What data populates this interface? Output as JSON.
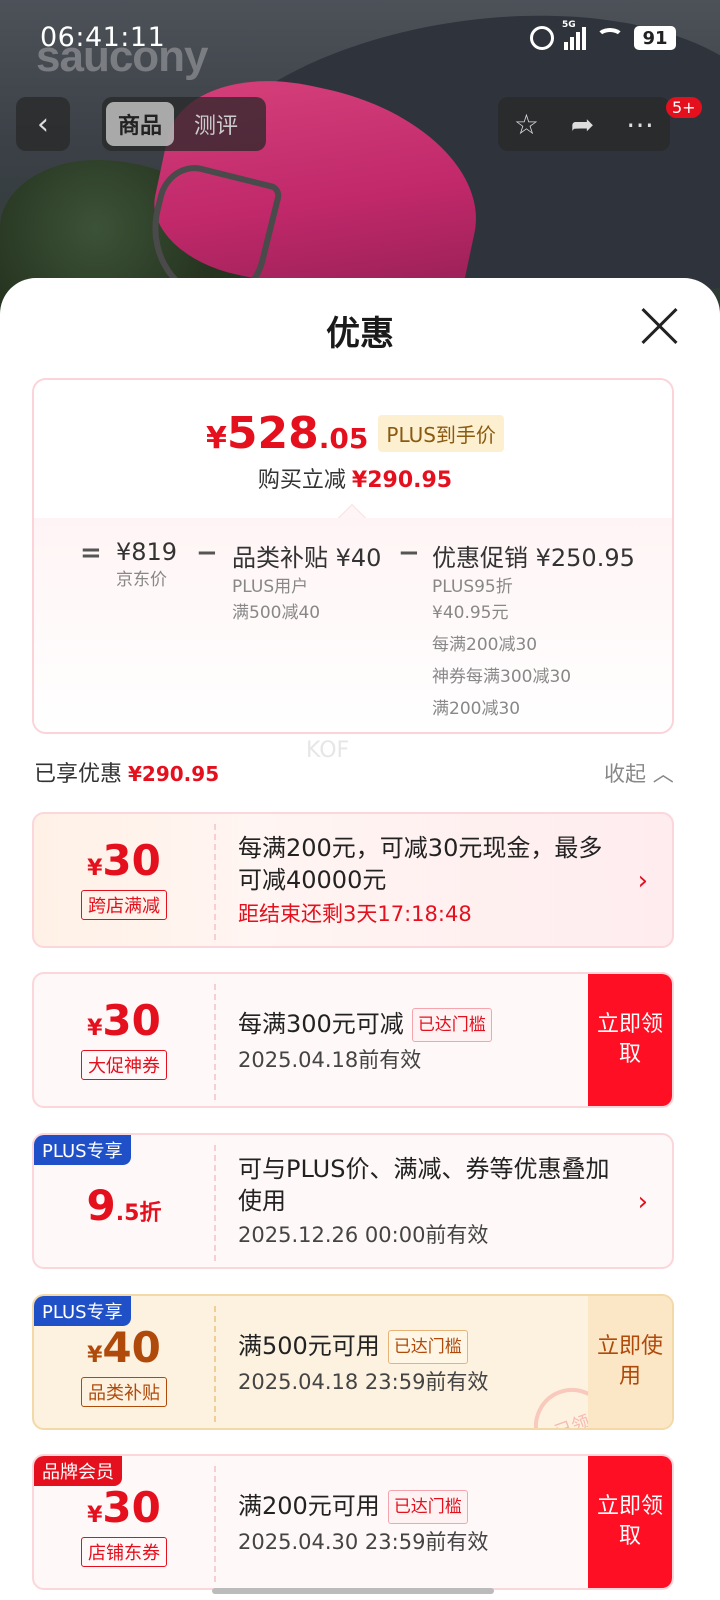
{
  "status": {
    "time": "06:41:11",
    "network": "5G",
    "battery": "91"
  },
  "background": {
    "brand": "saucony"
  },
  "nav": {
    "back_icon": "chevron-left-icon",
    "tabs": [
      {
        "label": "商品",
        "active": true
      },
      {
        "label": "测评",
        "active": false
      }
    ],
    "badge": "5+"
  },
  "sheet": {
    "title": "优惠",
    "summary": {
      "currency": "¥",
      "price_int": "528",
      "price_dec": ".05",
      "plus_label": "PLUS到手价",
      "reduce_label": "购买立减",
      "reduce_amount": "¥290.95",
      "eq": "=",
      "minus": "−",
      "base_price": "¥819",
      "base_label": "京东价",
      "category_title": "品类补贴 ¥40",
      "category_sub1": "PLUS用户",
      "category_sub2": "满500减40",
      "promo_title": "优惠促销 ¥250.95",
      "promo_items": [
        "PLUS95折",
        "¥40.95元",
        "每满200减30",
        "神券每满300减30",
        "满200减30"
      ]
    },
    "enjoyed_label": "已享优惠",
    "enjoyed_amount": "¥290.95",
    "collapse_label": "收起",
    "watermark": "KOF"
  },
  "coupons": [
    {
      "currency": "¥",
      "amount": "30",
      "type": "跨店满减",
      "desc": "每满200元，可减30元现金，最多可减40000元",
      "sub": "距结束还剩3天17:18:48"
    },
    {
      "currency": "¥",
      "amount": "30",
      "type": "大促神券",
      "desc": "每满300元可减",
      "reached": "已达门槛",
      "sub": "2025.04.18前有效",
      "action": "立即领取"
    },
    {
      "tag": "PLUS专享",
      "amount": "9",
      "amount_small": ".5折",
      "desc": "可与PLUS价、满减、券等优惠叠加使用",
      "sub": "2025.12.26 00:00前有效"
    },
    {
      "tag": "PLUS专享",
      "currency": "¥",
      "amount": "40",
      "type": "品类补贴",
      "desc": "满500元可用",
      "reached": "已达门槛",
      "sub": "2025.04.18 23:59前有效",
      "action": "立即使用",
      "stamp": "已领"
    },
    {
      "tag": "品牌会员",
      "currency": "¥",
      "amount": "30",
      "type": "店铺东券",
      "desc": "满200元可用",
      "reached": "已达门槛",
      "sub": "2025.04.30 23:59前有效",
      "action": "立即领取"
    }
  ]
}
